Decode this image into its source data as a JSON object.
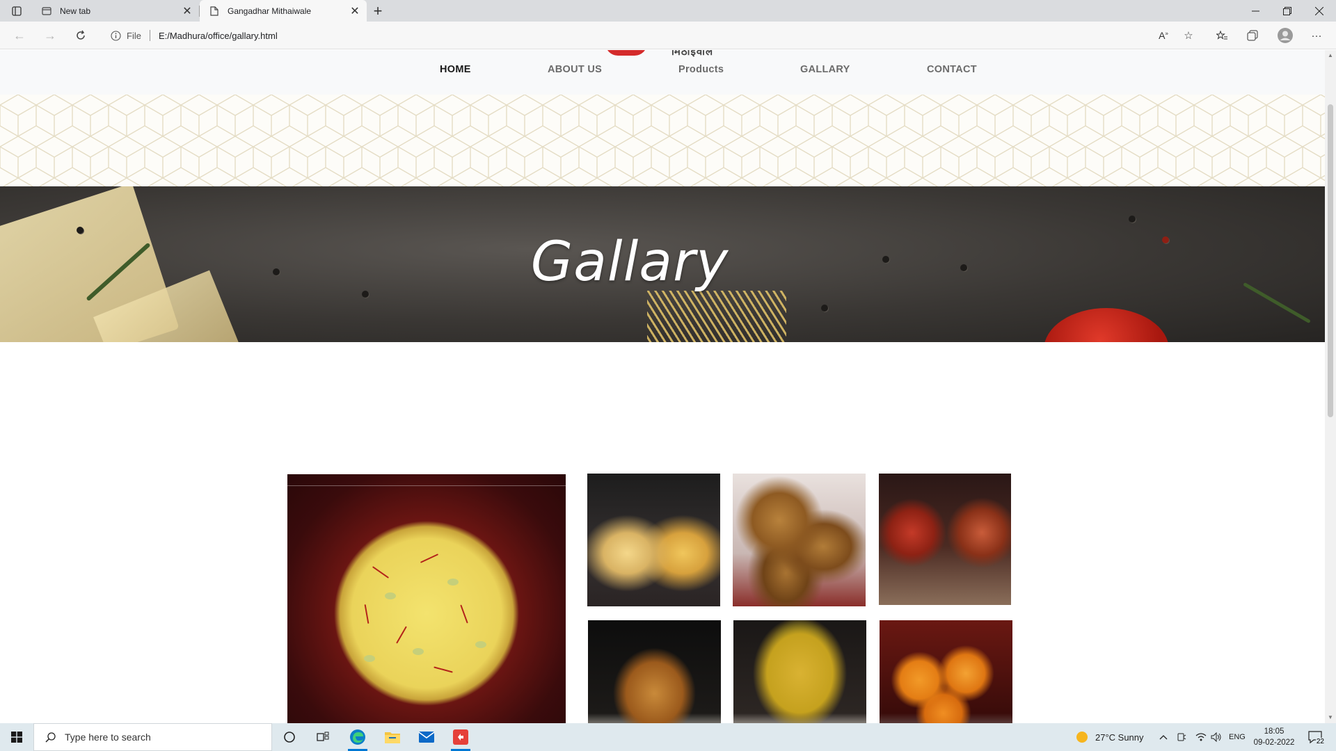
{
  "browser": {
    "tabs": [
      {
        "title": "New tab",
        "icon": "new-tab-page-icon"
      },
      {
        "title": "Gangadhar Mithaiwale",
        "icon": "page-icon"
      }
    ],
    "address": {
      "scheme_label": "File",
      "url": "E:/Madhura/office/gallary.html"
    }
  },
  "site": {
    "logo_text": "मिठाईवाले",
    "nav": [
      "HOME",
      "ABOUT US",
      "Products",
      "GALLARY",
      "CONTACT"
    ],
    "active_nav": "HOME"
  },
  "hero": {
    "title": "Gallary"
  },
  "gallery": {
    "images": [
      "rasmalai-bowl",
      "shrikhand-bowls",
      "bakarwadi",
      "gulab-jamun-bowls",
      "samosa-plate",
      "dhokla-plate",
      "motichoor-laddoo-plate"
    ]
  },
  "taskbar": {
    "search_placeholder": "Type here to search",
    "weather": "27°C  Sunny",
    "language": "ENG",
    "time": "18:05",
    "date": "09-02-2022",
    "notification_count": "22"
  },
  "colors": {
    "tabbar": "#dadcdf",
    "taskbar": "#dfe9ee",
    "edge_blue": "#0078d4"
  }
}
